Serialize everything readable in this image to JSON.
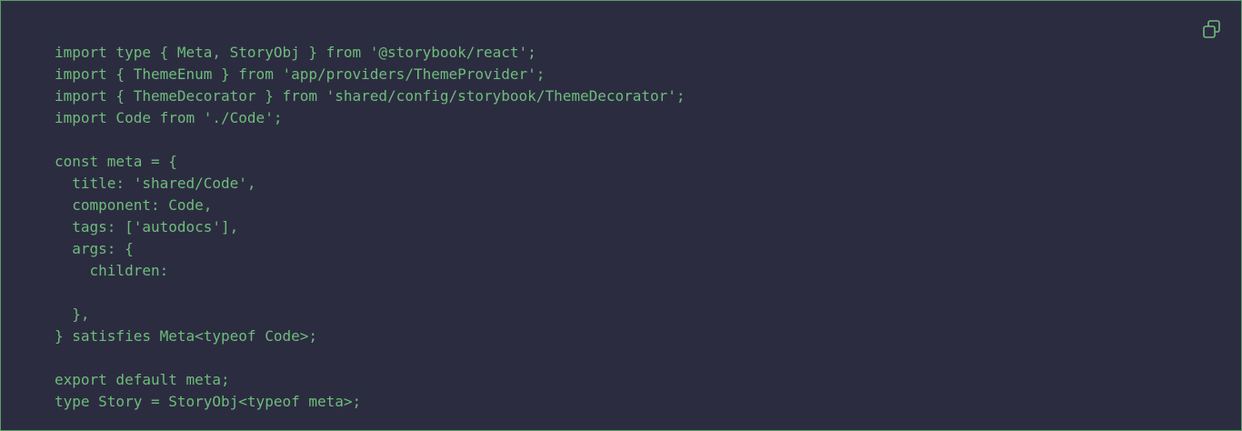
{
  "code_block": {
    "lines": [
      "import type { Meta, StoryObj } from '@storybook/react';",
      "import { ThemeEnum } from 'app/providers/ThemeProvider';",
      "import { ThemeDecorator } from 'shared/config/storybook/ThemeDecorator';",
      "import Code from './Code';",
      "",
      "const meta = {",
      "  title: 'shared/Code',",
      "  component: Code,",
      "  tags: ['autodocs'],",
      "  args: {",
      "    children:",
      "",
      "  },",
      "} satisfies Meta<typeof Code>;",
      "",
      "export default meta;",
      "type Story = StoryObj<typeof meta>;"
    ],
    "copy_icon": "copy-icon"
  },
  "colors": {
    "background": "#2c2c40",
    "text": "#6ebc7c",
    "border": "#5a9e68",
    "icon": "#6ebc7c"
  }
}
